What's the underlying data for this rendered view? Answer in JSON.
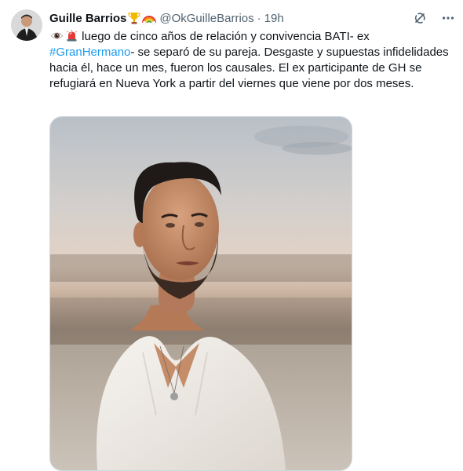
{
  "tweet": {
    "author_name": "Guille Barrios",
    "author_emojis": [
      "trophy-emoji",
      "rainbow-emoji"
    ],
    "handle": "@OkGuilleBarrios",
    "separator": "·",
    "time": "19h",
    "text_lead": "luego de cinco años de relación y convivencia BATI- ex",
    "lead_icons": [
      "eye-emoji",
      "siren-emoji"
    ],
    "hashtag": "#GranHermano",
    "text_rest": "- se separó de su pareja. Desgaste y supuestas infidelidades hacia él, hace un mes, fueron los causales. El ex participante de GH se refugiará en Nueva York a partir del viernes que viene por dos meses.",
    "header_icons": [
      "grok-icon",
      "more-icon"
    ]
  },
  "colors": {
    "link": "#1d9bf0",
    "secondary_text": "#536471",
    "primary_text": "#0f1419"
  }
}
